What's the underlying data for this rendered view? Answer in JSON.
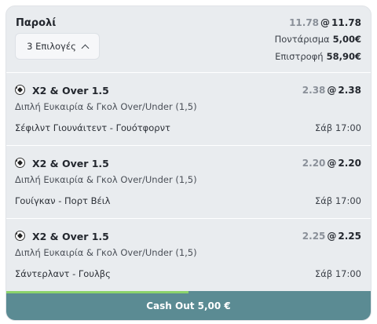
{
  "header": {
    "title": "Παρολί",
    "old_odds": "11.78",
    "at": "@",
    "new_odds": "11.78",
    "selections_label": "3 Επιλογές",
    "stake_label": "Ποντάρισμα",
    "stake_value": "5,00€",
    "return_label": "Επιστροφή",
    "return_value": "58,90€"
  },
  "bets": [
    {
      "market": "X2 & Over 1.5",
      "old_odds": "2.38",
      "new_odds": "2.38",
      "description": "Διπλή Ευκαιρία & Γκολ Over/Under (1,5)",
      "event": "Σέφιλντ Γιουνάιτεντ - Γουότφορντ",
      "time": "Σάβ 17:00"
    },
    {
      "market": "X2 & Over 1.5",
      "old_odds": "2.20",
      "new_odds": "2.20",
      "description": "Διπλή Ευκαιρία & Γκολ Over/Under (1,5)",
      "event": "Γουίγκαν - Πορτ Βέιλ",
      "time": "Σάβ 17:00"
    },
    {
      "market": "X2 & Over 1.5",
      "old_odds": "2.25",
      "new_odds": "2.25",
      "description": "Διπλή Ευκαιρία & Γκολ Over/Under (1,5)",
      "event": "Σάντερλαντ - Γουλβς",
      "time": "Σάβ 17:00"
    }
  ],
  "cashout": {
    "label": "Cash Out 5,00 €",
    "progress_percent": 50
  },
  "colors": {
    "card_bg": "#e9ecef",
    "cashout_bg": "#5b8b93",
    "progress": "#8bd36b"
  },
  "icons": {
    "sport": "football-icon",
    "expand": "chevron-up-icon"
  }
}
